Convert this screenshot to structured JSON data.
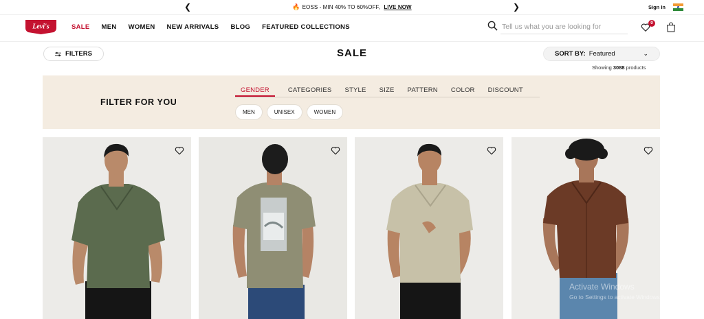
{
  "announcement": {
    "text": "EOSS - MIN 40% TO 60%OFF,",
    "cta": "LIVE NOW",
    "prev_icon": "chevron-left-icon",
    "next_icon": "chevron-right-icon"
  },
  "account": {
    "signin_label": "Sign In",
    "country_flag": "india-flag"
  },
  "brand": {
    "logo_text": "Levi's",
    "logo_color": "#c41230"
  },
  "nav": {
    "items": [
      "SALE",
      "MEN",
      "WOMEN",
      "NEW ARRIVALS",
      "BLOG",
      "FEATURED COLLECTIONS"
    ]
  },
  "search": {
    "placeholder": "Tell us what you are looking for",
    "icon": "search-icon"
  },
  "wishlist": {
    "count": "0",
    "icon": "heart-icon"
  },
  "cart": {
    "icon": "shopping-bag-icon"
  },
  "toolbar": {
    "filters_label": "FILTERS",
    "page_title": "SALE",
    "sort_label": "SORT BY:",
    "sort_value": "Featured",
    "showing_prefix": "Showing",
    "showing_count": "3088",
    "showing_suffix": "products"
  },
  "filter_for_you": {
    "heading": "FILTER FOR YOU",
    "tabs": [
      "GENDER",
      "CATEGORIES",
      "STYLE",
      "SIZE",
      "PATTERN",
      "COLOR",
      "DISCOUNT"
    ],
    "active_tab": "GENDER",
    "options": [
      "MEN",
      "UNISEX",
      "WOMEN"
    ],
    "background_color": "#f4ece1",
    "accent_color": "#c41230"
  },
  "products": [
    {
      "image": "man-in-green-short-sleeve-shirt",
      "shirt_color": "#5b6b4e",
      "pants_color": "#151515"
    },
    {
      "image": "man-in-olive-graphic-tee-back-view",
      "shirt_color": "#8f8e74",
      "pants_color": "#2c4a78"
    },
    {
      "image": "man-in-beige-camp-collar-shirt",
      "shirt_color": "#c7c1a8",
      "pants_color": "#151515"
    },
    {
      "image": "man-in-brown-camp-collar-shirt",
      "shirt_color": "#6b3a26",
      "pants_color": "#5b86ad"
    }
  ],
  "watermark": {
    "line1": "Activate Windows",
    "line2": "Go to Settings to activate Windows."
  }
}
